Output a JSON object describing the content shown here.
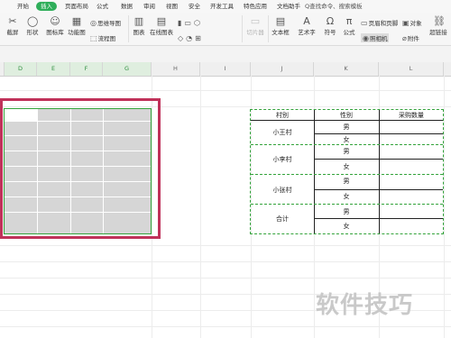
{
  "menu": {
    "tabs": [
      "开始",
      "插入",
      "页面布局",
      "公式",
      "数据",
      "审阅",
      "视图",
      "安全",
      "开发工具",
      "特色应用",
      "文档助手"
    ],
    "active": "插入",
    "search_text": "Q查找命令、搜索模板"
  },
  "ribbon": {
    "screenshot": "截屏",
    "shape": "形状",
    "iconlib": "图标库",
    "funcchart": "功能图",
    "mindmap": "思维导图",
    "flowchart": "流程图",
    "chart": "图表",
    "online_chart": "在线图表",
    "slicer": "切片器",
    "textbox": "文本框",
    "art": "艺术字",
    "symbol": "符号",
    "formula": "公式",
    "header_footer": "页眉和页脚",
    "photo": "照相机",
    "object": "对象",
    "attachment": "附件",
    "barcode": "超链接"
  },
  "columns": [
    "D",
    "E",
    "F",
    "G",
    "H",
    "I",
    "J",
    "K",
    "L"
  ],
  "table": {
    "headers": [
      "村别",
      "性别",
      "采购数量"
    ],
    "villages": [
      "小王村",
      "小李村",
      "小张村",
      "合计"
    ],
    "genders": [
      "男",
      "女"
    ]
  },
  "watermark": "软件技巧"
}
